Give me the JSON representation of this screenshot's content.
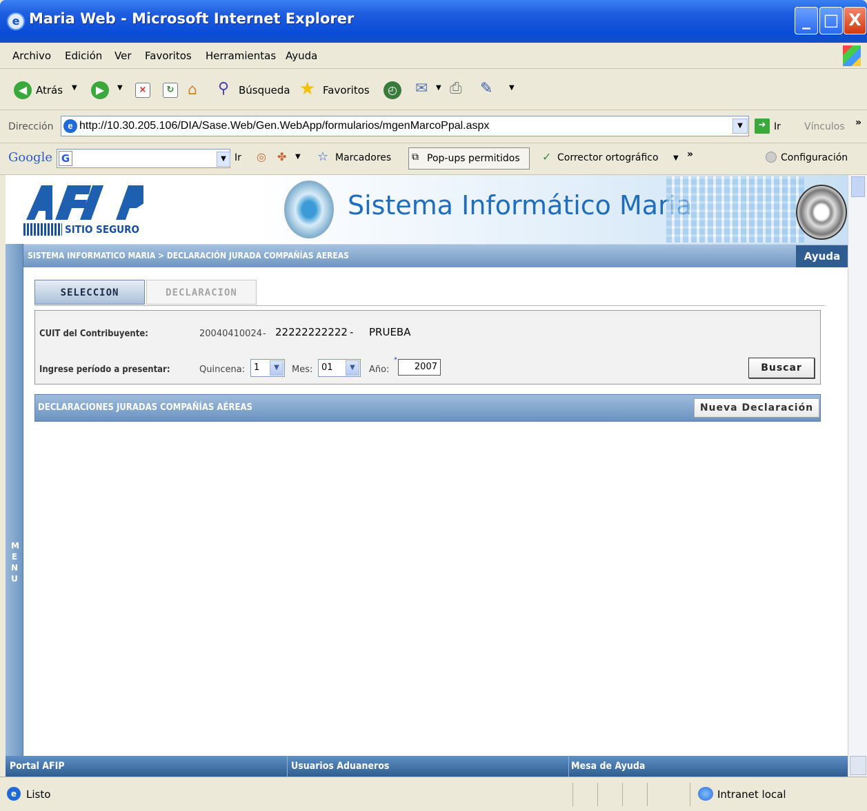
{
  "window": {
    "title": "Maria Web - Microsoft Internet Explorer",
    "min": "_",
    "max": "□",
    "close": "X"
  },
  "menu": [
    "Archivo",
    "Edición",
    "Ver",
    "Favoritos",
    "Herramientas",
    "Ayuda"
  ],
  "toolbar": {
    "back": "Atrás",
    "search": "Búsqueda",
    "favorites": "Favoritos"
  },
  "address": {
    "label": "Dirección",
    "url": "http://10.30.205.106/DIA/Sase.Web/Gen.WebApp/formularios/mgenMarcoPpal.aspx",
    "go": "Ir",
    "links": "Vínculos"
  },
  "google": {
    "logo": "Google",
    "go": "Ir",
    "bookmarks": "Marcadores",
    "popups": "Pop-ups permitidos",
    "spell": "Corrector ortográfico",
    "settings": "Configuración"
  },
  "header": {
    "logo_text": "SITIO SEGURO",
    "title": "Sistema Informático Maria"
  },
  "side": {
    "menu": "MENU"
  },
  "breadcrumb": "SISTEMA INFORMATICO MARIA > DECLARACIÓN JURADA COMPAÑÍAS AEREAS",
  "help_button": "Ayuda",
  "tabs": [
    {
      "label": "SELECCION"
    },
    {
      "label": "DECLARACION"
    }
  ],
  "form": {
    "cuit_label": "CUIT del Contribuyente:",
    "cuit_value": "20040410024",
    "cuit_sep1": "-",
    "cuit_value2": "22222222222",
    "cuit_sep2": "-",
    "cuit_name": "PRUEBA",
    "periodo_label": "Ingrese período a presentar:",
    "quincena_label": "Quincena:",
    "quincena_value": "1",
    "mes_label": "Mes:",
    "mes_value": "01",
    "anio_label": "Año:",
    "anio_required": "*",
    "anio_value": "2007",
    "buscar": "Buscar"
  },
  "list": {
    "title": "DECLARACIONES JURADAS COMPAÑÍAS AÉREAS",
    "new_button": "Nueva Declaración"
  },
  "footer": {
    "portal": "Portal AFIP",
    "usuarios": "Usuarios Aduaneros",
    "mesa": "Mesa de Ayuda"
  },
  "status": {
    "text": "Listo",
    "zone": "Intranet local"
  }
}
